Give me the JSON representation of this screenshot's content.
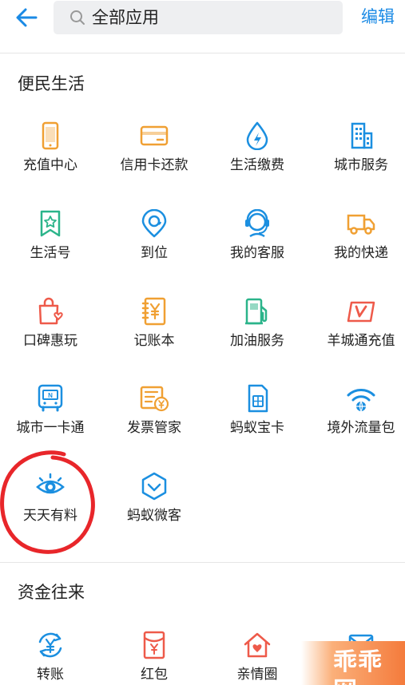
{
  "header": {
    "search_text": "全部应用",
    "edit_label": "编辑"
  },
  "sections": [
    {
      "title": "便民生活",
      "items": [
        {
          "label": "充值中心",
          "icon": "phone-icon",
          "color": "#f0a033"
        },
        {
          "label": "信用卡还款",
          "icon": "credit-card-icon",
          "color": "#f0a033"
        },
        {
          "label": "生活缴费",
          "icon": "water-bolt-icon",
          "color": "#1b8fe0"
        },
        {
          "label": "城市服务",
          "icon": "building-icon",
          "color": "#1b8fe0"
        },
        {
          "label": "生活号",
          "icon": "star-bookmark-icon",
          "color": "#2bb48a"
        },
        {
          "label": "到位",
          "icon": "location-pin-icon",
          "color": "#1b8fe0"
        },
        {
          "label": "我的客服",
          "icon": "headset-agent-icon",
          "color": "#1b8fe0"
        },
        {
          "label": "我的快递",
          "icon": "delivery-truck-icon",
          "color": "#f0a033"
        },
        {
          "label": "口碑惠玩",
          "icon": "shopping-bag-heart-icon",
          "color": "#ee5a4a"
        },
        {
          "label": "记账本",
          "icon": "yen-ledger-icon",
          "color": "#f0a033"
        },
        {
          "label": "加油服务",
          "icon": "fuel-pump-icon",
          "color": "#2bb48a"
        },
        {
          "label": "羊城通充值",
          "icon": "v-card-icon",
          "color": "#ee5a4a"
        },
        {
          "label": "城市一卡通",
          "icon": "bus-card-icon",
          "color": "#1b8fe0"
        },
        {
          "label": "发票管家",
          "icon": "invoice-yen-icon",
          "color": "#f0a033"
        },
        {
          "label": "蚂蚁宝卡",
          "icon": "sim-card-icon",
          "color": "#1b8fe0"
        },
        {
          "label": "境外流量包",
          "icon": "wifi-globe-icon",
          "color": "#1b8fe0"
        },
        {
          "label": "天天有料",
          "icon": "eye-icon",
          "color": "#1b8fe0"
        },
        {
          "label": "蚂蚁微客",
          "icon": "shield-check-icon",
          "color": "#1b8fe0"
        }
      ]
    },
    {
      "title": "资金往来",
      "items": [
        {
          "label": "转账",
          "icon": "transfer-yen-icon",
          "color": "#1b8fe0"
        },
        {
          "label": "红包",
          "icon": "red-packet-icon",
          "color": "#ee5a4a"
        },
        {
          "label": "亲情圈",
          "icon": "family-house-icon",
          "color": "#ee5a4a"
        },
        {
          "label": "",
          "icon": "envelope-icon",
          "color": "#1b8fe0"
        }
      ]
    }
  ],
  "watermark": "乖乖网",
  "colors": {
    "accent": "#1a8ae5",
    "annotation": "#e8262a"
  }
}
